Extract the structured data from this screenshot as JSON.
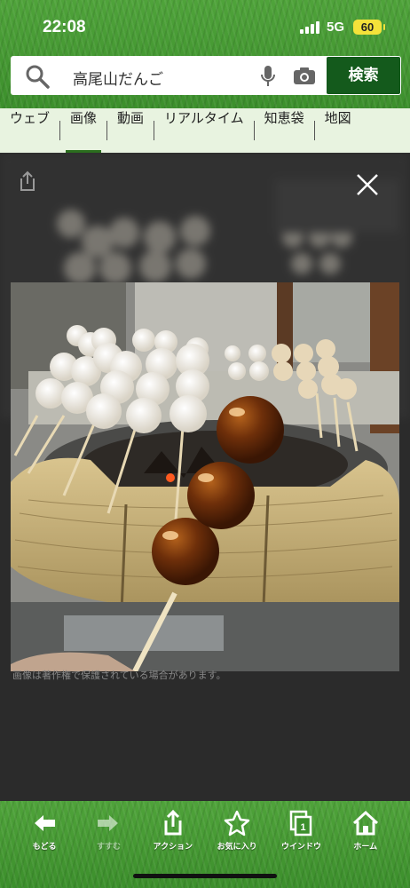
{
  "status": {
    "time": "22:08",
    "network": "5G",
    "battery": "60"
  },
  "search": {
    "query": "高尾山だんご",
    "button": "検索"
  },
  "tabs": [
    {
      "label": "ウェブ"
    },
    {
      "label": "画像",
      "active": true
    },
    {
      "label": "動画"
    },
    {
      "label": "リアルタイム"
    },
    {
      "label": "知恵袋"
    },
    {
      "label": "地図"
    }
  ],
  "viewer": {
    "caption": "画像は著作権で保護されている場合があります。"
  },
  "toolbar": [
    {
      "label": "もどる",
      "icon": "back-arrow-icon"
    },
    {
      "label": "すすむ",
      "icon": "forward-arrow-icon"
    },
    {
      "label": "アクション",
      "icon": "share-icon"
    },
    {
      "label": "お気に入り",
      "icon": "star-icon"
    },
    {
      "label": "ウインドウ",
      "icon": "windows-icon"
    },
    {
      "label": "ホーム",
      "icon": "home-icon"
    }
  ],
  "colors": {
    "brand_green": "#3c8f2c",
    "search_button": "#145a1c",
    "tab_bar": "#e8f3e0"
  }
}
